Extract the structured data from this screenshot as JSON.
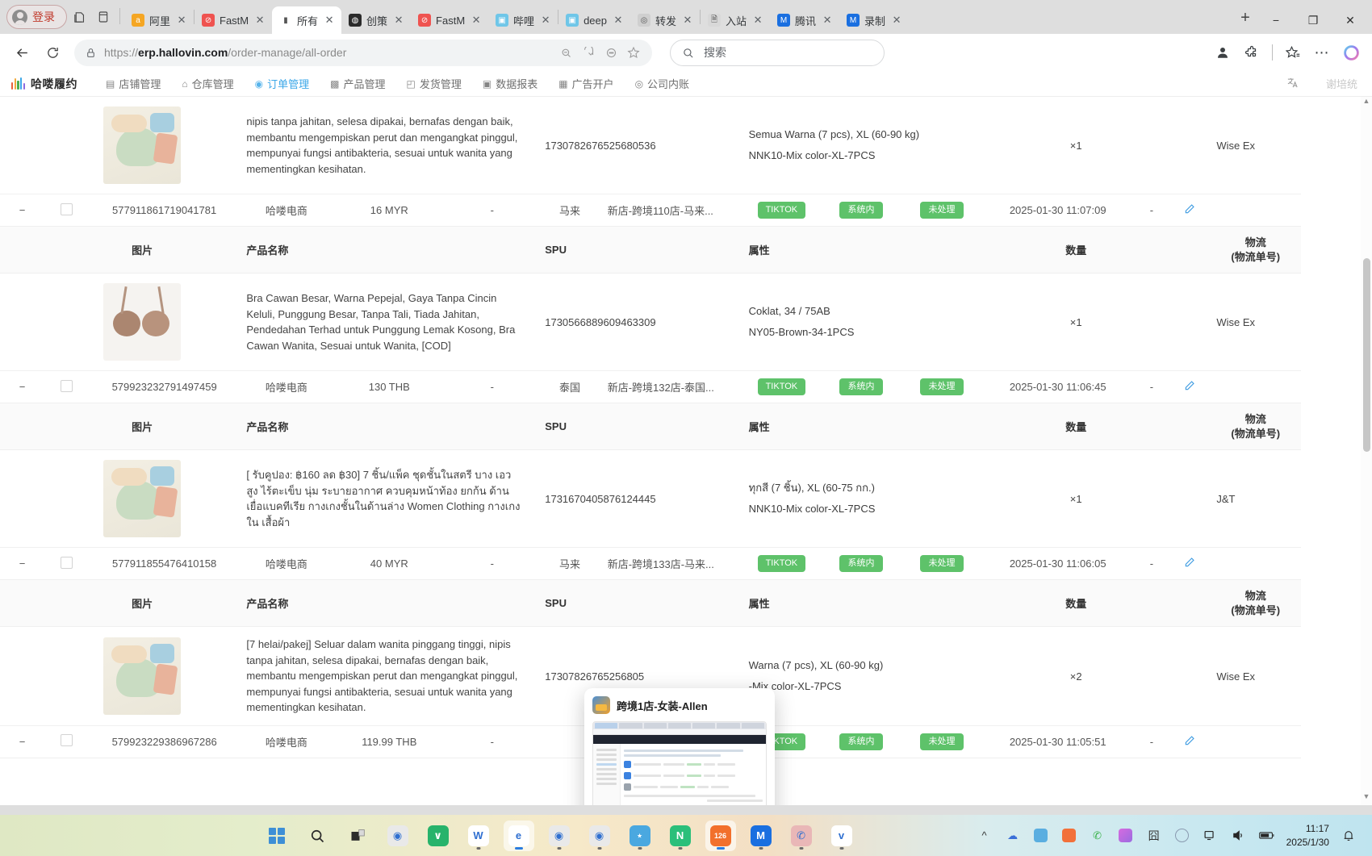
{
  "browser": {
    "profile_label": "登录",
    "tabs": [
      {
        "label": "阿里",
        "favicon": "ali-icon",
        "color": "#f5a623",
        "glyph": "a",
        "active": false
      },
      {
        "label": "FastM",
        "favicon": "fastmoss-icon",
        "color": "#ef5350",
        "glyph": "⊘",
        "active": false
      },
      {
        "label": "所有",
        "favicon": "erp-icon",
        "color": "#ffffff",
        "glyph": "▮",
        "active": true
      },
      {
        "label": "创策",
        "favicon": "drop-icon",
        "color": "#2b2b2b",
        "glyph": "◍",
        "active": false
      },
      {
        "label": "FastM",
        "favicon": "fastmoss-icon",
        "color": "#ef5350",
        "glyph": "⊘",
        "active": false
      },
      {
        "label": "哔哩",
        "favicon": "bilibili-icon",
        "color": "#6fc6e8",
        "glyph": "▣",
        "active": false
      },
      {
        "label": "deep",
        "favicon": "deepseek-icon",
        "color": "#6fc6e8",
        "glyph": "▣",
        "active": false
      },
      {
        "label": "转发",
        "favicon": "forward-icon",
        "color": "#cfcfcf",
        "glyph": "◎",
        "active": false
      },
      {
        "label": "入站",
        "favicon": "page-icon",
        "color": "#d8d8d8",
        "glyph": "🗎",
        "active": false
      },
      {
        "label": "腾讯",
        "favicon": "tencent-icon",
        "color": "#1a6fe0",
        "glyph": "M",
        "active": false
      },
      {
        "label": "录制",
        "favicon": "record-icon",
        "color": "#1a6fe0",
        "glyph": "M",
        "active": false
      }
    ],
    "new_tab_label": "+",
    "window_controls": {
      "minimize": "−",
      "maximize": "❐",
      "close": "✕"
    },
    "back_icon": "back-arrow-icon",
    "reload_icon": "reload-icon",
    "url_prefix": "https://",
    "url_domain": "erp.hallovin.com",
    "url_path": "/order-manage/all-order",
    "url_lock_icon": "lock-icon",
    "url_actions": [
      "zoom-out-icon",
      "reading-mode-icon",
      "more-circle-icon",
      "bookmark-star-icon"
    ],
    "search_placeholder": "搜索",
    "search_icon": "search-icon",
    "toolbar_right_icons": [
      "avatar-icon",
      "extensions-icon",
      "favorites-icon",
      "settings-more-icon",
      "copilot-icon"
    ]
  },
  "appnav": {
    "brand": "哈喽履约",
    "items": [
      {
        "label": "店铺管理",
        "icon": "shop-icon",
        "active": false
      },
      {
        "label": "仓库管理",
        "icon": "warehouse-icon",
        "active": false
      },
      {
        "label": "订单管理",
        "icon": "order-icon",
        "active": true
      },
      {
        "label": "产品管理",
        "icon": "product-icon",
        "active": false
      },
      {
        "label": "发货管理",
        "icon": "shipping-icon",
        "active": false
      },
      {
        "label": "数据报表",
        "icon": "report-icon",
        "active": false
      },
      {
        "label": "广告开户",
        "icon": "ad-icon",
        "active": false
      },
      {
        "label": "公司内账",
        "icon": "account-icon",
        "active": false
      }
    ],
    "translate_icon": "translate-icon",
    "username": "谢培统",
    "active_color": "#3ba7e8"
  },
  "table": {
    "sub_headers": {
      "image": "图片",
      "product_name": "产品名称",
      "spu": "SPU",
      "attribute": "属性",
      "quantity": "数量",
      "logistics": "物流",
      "logistics_sub": "(物流单号)"
    },
    "groups": [
      {
        "partial_top": true,
        "item": {
          "thumb": "clothes",
          "product_name": "nipis tanpa jahitan, selesa dipakai, bernafas dengan baik, membantu mengempiskan perut dan mengangkat pinggul, mempunyai fungsi antibakteria, sesuai untuk wanita yang mementingkan kesihatan.",
          "spu": "1730782676525680536",
          "attr1": "Semua Warna (7 pcs), XL (60-90 kg)",
          "attr2": "NNK10-Mix color-XL-7PCS",
          "qty": "×1",
          "logistics": "Wise Ex"
        },
        "summary": {
          "expander": "−",
          "order_no": "577911861719041781",
          "company": "哈喽电商",
          "amount": "16 MYR",
          "blank": "-",
          "country": "马来",
          "store": "新店-跨境110店-马来...",
          "badges": [
            "TIKTOK",
            "系统内",
            "未处理"
          ],
          "time": "2025-01-30 11:07:09",
          "tail": "-",
          "edit_icon": "edit-pencil-icon"
        }
      },
      {
        "partial_top": false,
        "item": {
          "thumb": "bra",
          "product_name": "Bra Cawan Besar, Warna Pepejal, Gaya Tanpa Cincin Keluli, Punggung Besar, Tanpa Tali, Tiada Jahitan, Pendedahan Terhad untuk Punggung Lemak Kosong, Bra Cawan Wanita, Sesuai untuk Wanita, [COD]",
          "spu": "1730566889609463309",
          "attr1": "Coklat, 34 / 75AB",
          "attr2": "NY05-Brown-34-1PCS",
          "qty": "×1",
          "logistics": "Wise Ex"
        },
        "summary": {
          "expander": "−",
          "order_no": "579923232791497459",
          "company": "哈喽电商",
          "amount": "130 THB",
          "blank": "-",
          "country": "泰国",
          "store": "新店-跨境132店-泰国...",
          "badges": [
            "TIKTOK",
            "系统内",
            "未处理"
          ],
          "time": "2025-01-30 11:06:45",
          "tail": "-",
          "edit_icon": "edit-pencil-icon"
        }
      },
      {
        "partial_top": false,
        "item": {
          "thumb": "clothes",
          "product_name": "[ รับคูปอง: ฿160 ลด ฿30] 7 ชิ้น/แพ็ค ชุดชั้นในสตรี บาง เอวสูง ไร้ตะเข็บ นุ่ม ระบายอากาศ ควบคุมหน้าท้อง ยกก้น ด้านเยื่อแบคทีเรีย กางเกงชั้นในด้านล่าง Women Clothing กางเกงใน เสื้อผ้า",
          "spu": "1731670405876124445",
          "attr1": "ทุกสี (7 ชิ้น), XL (60-75 กก.)",
          "attr2": "NNK10-Mix color-XL-7PCS",
          "qty": "×1",
          "logistics": "J&T"
        },
        "summary": {
          "expander": "−",
          "order_no": "577911855476410158",
          "company": "哈喽电商",
          "amount": "40 MYR",
          "blank": "-",
          "country": "马来",
          "store": "新店-跨境133店-马来...",
          "badges": [
            "TIKTOK",
            "系统内",
            "未处理"
          ],
          "time": "2025-01-30 11:06:05",
          "tail": "-",
          "edit_icon": "edit-pencil-icon"
        }
      },
      {
        "partial_top": false,
        "item": {
          "thumb": "clothes",
          "product_name": "[7 helai/pakej] Seluar dalam wanita pinggang tinggi, nipis tanpa jahitan, selesa dipakai, bernafas dengan baik, membantu mengempiskan perut dan mengangkat pinggul, mempunyai fungsi antibakteria, sesuai untuk wanita yang mementingkan kesihatan.",
          "spu": "17307826765256805",
          "attr1": "Warna (7 pcs), XL (60-90 kg)",
          "attr2": "-Mix color-XL-7PCS",
          "qty": "×2",
          "logistics": "Wise Ex"
        },
        "summary": {
          "expander": "−",
          "order_no": "579923229386967286",
          "company": "哈喽电商",
          "amount": "119.99 THB",
          "blank": "-",
          "country": "",
          "store": "",
          "badges": [
            "TIKTOK",
            "系统内",
            "未处理"
          ],
          "time": "2025-01-30 11:05:51",
          "tail": "-",
          "edit_icon": "edit-pencil-icon"
        }
      }
    ]
  },
  "popup": {
    "title": "跨境1店-女装-Allen",
    "logo_icon": "browser-profile-icon"
  },
  "taskbar": {
    "start_icon": "windows-start-icon",
    "search_icon": "taskbar-search-icon",
    "taskview_icon": "task-view-icon",
    "apps": [
      {
        "name": "chrome-icon",
        "color": "#e9e9e9",
        "glyph": "◉",
        "running": false
      },
      {
        "name": "wps-green-icon",
        "color": "#27b36b",
        "glyph": "∨",
        "running": false
      },
      {
        "name": "wps-writer-icon",
        "color": "#ffffff",
        "glyph": "W",
        "running": true
      },
      {
        "name": "edge-icon",
        "color": "#ffffff",
        "glyph": "e",
        "running": true,
        "selected": true
      },
      {
        "name": "chrome-profile-1-icon",
        "color": "#e9e9e9",
        "glyph": "◉",
        "running": true
      },
      {
        "name": "chrome-profile-2-icon",
        "color": "#e9e9e9",
        "glyph": "◉",
        "running": true
      },
      {
        "name": "share-node-icon",
        "color": "#4aa8e0",
        "glyph": "⋆",
        "running": true
      },
      {
        "name": "notion-icon",
        "color": "#2bbf7a",
        "glyph": "N",
        "running": true
      },
      {
        "name": "migu-126-icon",
        "color": "#ffffff",
        "glyph": "126",
        "running": true,
        "selected": true
      },
      {
        "name": "migu-blue-icon",
        "color": "#1a6fe0",
        "glyph": "M",
        "running": true
      },
      {
        "name": "wechat-icon",
        "color": "#e9b7b7",
        "glyph": "✆",
        "running": true
      },
      {
        "name": "dove-icon",
        "color": "#ffffff",
        "glyph": "v",
        "running": true
      }
    ],
    "tray_chevron": "^",
    "tray_icons": [
      "onedrive-icon",
      "network-blue-icon",
      "orange-app-icon",
      "wechat-tray-icon",
      "purple-app-icon",
      "pattern-app-icon",
      "jslly-icon"
    ],
    "system_icons": [
      "monitor-icon",
      "volume-icon",
      "battery-icon"
    ],
    "clock_time": "11:17",
    "clock_date": "2025/1/30",
    "notification_icon": "notification-bell-icon"
  }
}
